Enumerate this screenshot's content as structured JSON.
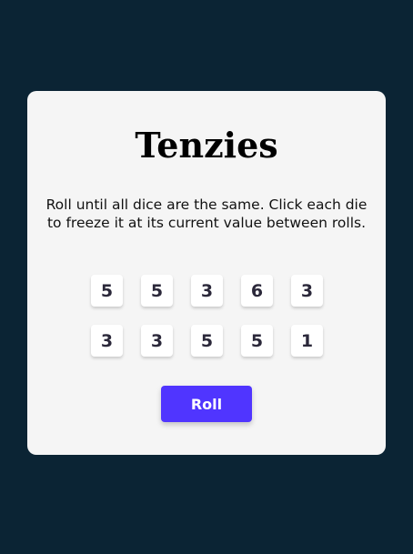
{
  "app": {
    "title": "Tenzies",
    "instructions": "Roll until all dice are the same. Click each die to freeze it at its current value between rolls."
  },
  "dice": [
    {
      "value": "5",
      "held": false
    },
    {
      "value": "5",
      "held": false
    },
    {
      "value": "3",
      "held": false
    },
    {
      "value": "6",
      "held": false
    },
    {
      "value": "3",
      "held": false
    },
    {
      "value": "3",
      "held": false
    },
    {
      "value": "3",
      "held": false
    },
    {
      "value": "5",
      "held": false
    },
    {
      "value": "5",
      "held": false
    },
    {
      "value": "1",
      "held": false
    }
  ],
  "controls": {
    "roll_label": "Roll"
  },
  "colors": {
    "background": "#0b2434",
    "card": "#f5f5f5",
    "die_face": "#ffffff",
    "die_text": "#2b283a",
    "accent": "#5035ff"
  }
}
